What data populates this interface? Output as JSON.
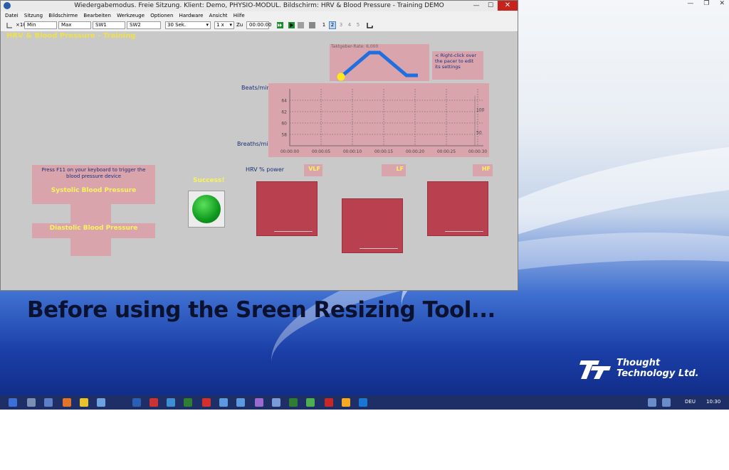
{
  "window": {
    "title": "Wiedergabemodus. Freie Sitzung. Klient: Demo, PHYSIO-MODUL. Bildschirm: HRV & Blood Pressure - Training DEMO",
    "close_label": "✕"
  },
  "menu": [
    "Datei",
    "Sitzung",
    "Bildschirme",
    "Bearbeiten",
    "Werkzeuge",
    "Optionen",
    "Hardware",
    "Ansicht",
    "Hilfe"
  ],
  "toolbar": {
    "zoom_label": "×10",
    "min_label": "Min",
    "max_label": "Max",
    "sw1_label": "SW1",
    "sw2_label": "SW2",
    "duration_value": "30 Sek.",
    "speed_value": "1 x",
    "goto_label": "Zu",
    "time_value": "00:00:00",
    "pages": [
      "1",
      "2",
      "3",
      "4",
      "5"
    ],
    "active_page": "2"
  },
  "screen": {
    "title": "HRV & Blood Pressure - Training",
    "pacer_label": "Taktgeber-Rate: 6,000",
    "pacer_hint": "< Right-click over the pacer to edit its settings",
    "beats_label": "Beats/min",
    "breaths_label": "Breaths/min",
    "bp_instruction": "Press F11 on your keyboard to trigger the blood pressure device",
    "systolic_label": "Systolic Blood Pressure",
    "diastolic_label": "Diastolic Blood Pressure",
    "success_label": "Success!",
    "hrv_label": "HRV % power",
    "vlf_label": "VLF",
    "lf_label": "LF",
    "hf_label": "HF"
  },
  "chart_data": {
    "type": "line",
    "title": "",
    "xlabel": "",
    "ylabel": "Beats/min",
    "y2label": "Breaths/min",
    "x_ticks": [
      "00:00:00",
      "00:00:05",
      "00:00:10",
      "00:00:15",
      "00:00:20",
      "00:00:25",
      "00:00:30"
    ],
    "y_ticks": [
      58,
      60,
      62,
      64
    ],
    "y2_ticks": [
      50,
      100
    ],
    "ylim": [
      56,
      66
    ],
    "grid": true,
    "series": []
  },
  "desktop": {
    "caption": "Before using the Sreen Resizing Tool...",
    "logo_line1": "Thought",
    "logo_line2": "Technology Ltd.",
    "tray_lang": "DEU",
    "tray_time": "10:30",
    "colors": {
      "accent_yellow": "#f7f35c",
      "panel_pink": "#d9a4ac",
      "bar_crimson": "#b8404f",
      "pacer_blue": "#1f6fe0",
      "pacer_ball": "#ffe81a"
    }
  }
}
